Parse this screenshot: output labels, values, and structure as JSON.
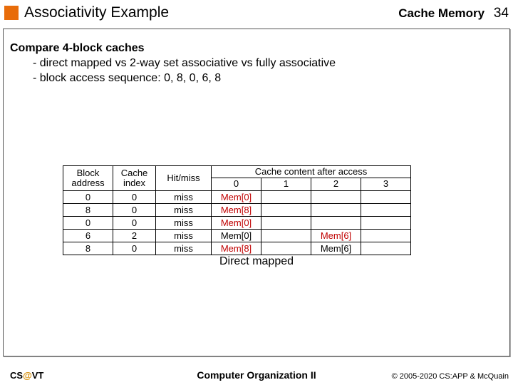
{
  "header": {
    "title": "Associativity Example",
    "right_label": "Cache Memory",
    "page_number": "34"
  },
  "body": {
    "line1": "Compare 4-block caches",
    "line2": "-  direct mapped vs 2-way set associative vs fully associative",
    "line3": "-  block access sequence: 0, 8, 0, 6, 8"
  },
  "table": {
    "h_block_address": "Block address",
    "h_cache_index": "Cache index",
    "h_hitmiss": "Hit/miss",
    "h_content": "Cache content after access",
    "h_c0": "0",
    "h_c1": "1",
    "h_c2": "2",
    "h_c3": "3",
    "rows": [
      {
        "ba": "0",
        "ci": "0",
        "hm": "miss",
        "c0": "Mem[0]",
        "c0_red": true,
        "c1": "",
        "c2": "",
        "c2_red": false,
        "c3": ""
      },
      {
        "ba": "8",
        "ci": "0",
        "hm": "miss",
        "c0": "Mem[8]",
        "c0_red": true,
        "c1": "",
        "c2": "",
        "c2_red": false,
        "c3": ""
      },
      {
        "ba": "0",
        "ci": "0",
        "hm": "miss",
        "c0": "Mem[0]",
        "c0_red": true,
        "c1": "",
        "c2": "",
        "c2_red": false,
        "c3": ""
      },
      {
        "ba": "6",
        "ci": "2",
        "hm": "miss",
        "c0": "Mem[0]",
        "c0_red": false,
        "c1": "",
        "c2": "Mem[6]",
        "c2_red": true,
        "c3": ""
      },
      {
        "ba": "8",
        "ci": "0",
        "hm": "miss",
        "c0": "Mem[8]",
        "c0_red": true,
        "c1": "",
        "c2": "Mem[6]",
        "c2_red": false,
        "c3": ""
      }
    ],
    "caption": "Direct mapped"
  },
  "footer": {
    "left_a": "CS",
    "left_at": "@",
    "left_b": "VT",
    "center": "Computer Organization II",
    "right": "© 2005-2020 CS:APP & McQuain"
  },
  "chart_data": {
    "type": "table",
    "title": "Direct mapped cache trace (4 blocks)",
    "columns": [
      "Block address",
      "Cache index",
      "Hit/miss",
      "Content[0]",
      "Content[1]",
      "Content[2]",
      "Content[3]"
    ],
    "rows": [
      [
        "0",
        "0",
        "miss",
        "Mem[0]",
        "",
        "",
        ""
      ],
      [
        "8",
        "0",
        "miss",
        "Mem[8]",
        "",
        "",
        ""
      ],
      [
        "0",
        "0",
        "miss",
        "Mem[0]",
        "",
        "",
        ""
      ],
      [
        "6",
        "2",
        "miss",
        "Mem[0]",
        "",
        "Mem[6]",
        ""
      ],
      [
        "8",
        "0",
        "miss",
        "Mem[8]",
        "",
        "Mem[6]",
        ""
      ]
    ]
  }
}
